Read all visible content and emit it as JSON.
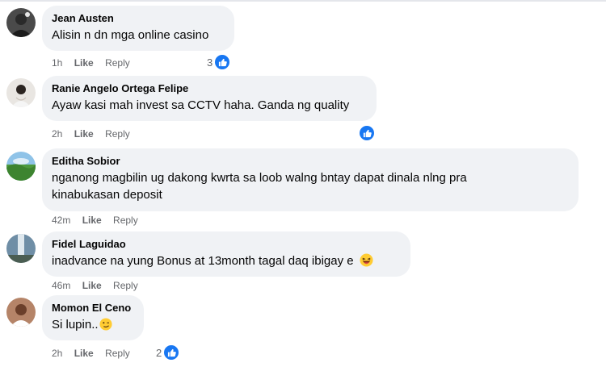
{
  "comments": [
    {
      "author": "Jean Austen",
      "text_lines": [
        "Alisin n dn mga online casino"
      ],
      "time": "1h",
      "like_label": "Like",
      "reply_label": "Reply",
      "reaction_count": "3",
      "avatar_color": "#3b3b3b"
    },
    {
      "author": "Ranie Angelo Ortega Felipe",
      "text_lines": [
        "Ayaw kasi mah invest sa CCTV haha. Ganda ng quality"
      ],
      "time": "2h",
      "like_label": "Like",
      "reply_label": "Reply",
      "reaction_count": "",
      "avatar_color": "#d8d4cf"
    },
    {
      "author": "Editha Sobior",
      "text_lines": [
        "nganong magbilin ug dakong kwrta sa loob walng bntay dapat dinala nlng pra",
        "kinabukasan deposit"
      ],
      "time": "42m",
      "like_label": "Like",
      "reply_label": "Reply",
      "reaction_count": "",
      "avatar_color": "#5aa04a"
    },
    {
      "author": "Fidel Laguidao",
      "text_lines": [
        "inadvance na yung Bonus at 13month tagal daq ibigay e"
      ],
      "time": "46m",
      "like_label": "Like",
      "reply_label": "Reply",
      "reaction_count": "",
      "avatar_color": "#5b7d96"
    },
    {
      "author": "Momon El Ceno",
      "text_lines": [
        "Si lupin.."
      ],
      "time": "2h",
      "like_label": "Like",
      "reply_label": "Reply",
      "reaction_count": "2",
      "avatar_color": "#9a6b52"
    }
  ],
  "colors": {
    "bubble": "#f0f2f5",
    "meta_text": "#65676b",
    "like_blue": "#1877f2"
  },
  "icons": {
    "reaction": "thumbs-up-icon",
    "laugh_emoji": "laughing-emoji-icon",
    "smirk_emoji": "smirk-emoji-icon"
  }
}
